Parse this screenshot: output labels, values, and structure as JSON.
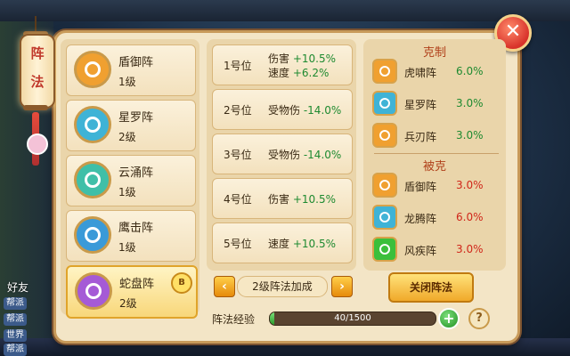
{
  "lantern": {
    "title": "阵法"
  },
  "hud": {
    "friends": "好友",
    "chat": [
      "帮派",
      "帮派",
      "世界",
      "帮派"
    ]
  },
  "formations": [
    {
      "name": "盾御阵",
      "level": "1级",
      "icon": "shield-formation-icon",
      "color": "#f0a030"
    },
    {
      "name": "星罗阵",
      "level": "2级",
      "icon": "star-formation-icon",
      "color": "#3fb3d6"
    },
    {
      "name": "云涌阵",
      "level": "1级",
      "icon": "cloud-formation-icon",
      "color": "#3fbfa8"
    },
    {
      "name": "鹰击阵",
      "level": "1级",
      "icon": "eagle-formation-icon",
      "color": "#3a9ad8"
    },
    {
      "name": "蛇盘阵",
      "level": "2级",
      "icon": "snake-formation-icon",
      "color": "#a55ad6",
      "badge": "B"
    }
  ],
  "positions": [
    {
      "label": "1号位",
      "effects": [
        {
          "name": "伤害",
          "value": "+10.5%"
        },
        {
          "name": "速度",
          "value": "+6.2%"
        }
      ]
    },
    {
      "label": "2号位",
      "effects": [
        {
          "name": "受物伤",
          "value": "-14.0%"
        }
      ]
    },
    {
      "label": "3号位",
      "effects": [
        {
          "name": "受物伤",
          "value": "-14.0%"
        }
      ]
    },
    {
      "label": "4号位",
      "effects": [
        {
          "name": "伤害",
          "value": "+10.5%"
        }
      ]
    },
    {
      "label": "5号位",
      "effects": [
        {
          "name": "速度",
          "value": "+10.5%"
        }
      ]
    }
  ],
  "bonus": {
    "label": "2级阵法加成"
  },
  "counters": {
    "title": "克制",
    "items": [
      {
        "name": "虎啸阵",
        "value": "6.0%",
        "color": "#1e8a30",
        "icon": "tiger-formation-icon",
        "iconColor": "#f0a030"
      },
      {
        "name": "星罗阵",
        "value": "3.0%",
        "color": "#1e8a30",
        "icon": "star-formation-icon",
        "iconColor": "#3fb3d6"
      },
      {
        "name": "兵刃阵",
        "value": "3.0%",
        "color": "#1e8a30",
        "icon": "blade-formation-icon",
        "iconColor": "#f0a030"
      }
    ]
  },
  "countered": {
    "title": "被克",
    "items": [
      {
        "name": "盾御阵",
        "value": "3.0%",
        "color": "#d0261a",
        "icon": "shield-formation-icon",
        "iconColor": "#f0a030"
      },
      {
        "name": "龙腾阵",
        "value": "6.0%",
        "color": "#d0261a",
        "icon": "dragon-formation-icon",
        "iconColor": "#3fb3d6"
      },
      {
        "name": "风疾阵",
        "value": "3.0%",
        "color": "#d0261a",
        "icon": "wind-formation-icon",
        "iconColor": "#3bbf3b"
      }
    ]
  },
  "close_formation": "关闭阵法",
  "experience": {
    "label": "阵法经验",
    "text": "40/1500",
    "fraction": 0.027
  }
}
